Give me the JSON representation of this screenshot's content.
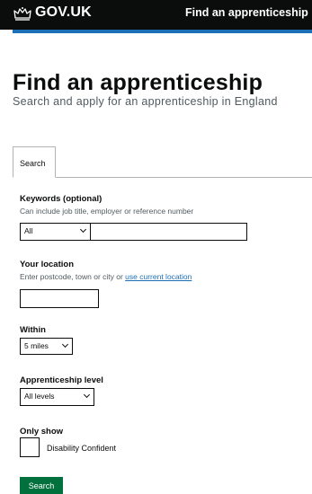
{
  "header": {
    "logo_text": "GOV.UK",
    "service_name": "Find an apprenticeship",
    "background": "#0b0c0c",
    "stripe_color": "#1d70b8"
  },
  "page": {
    "title": "Find an apprenticeship",
    "subtitle": "Search and apply for an apprenticeship in England"
  },
  "tabs": [
    {
      "label": "Search"
    }
  ],
  "form": {
    "keywords": {
      "label": "Keywords (optional)",
      "hint": "Can include job title, employer or reference number",
      "category_value": "All",
      "value": ""
    },
    "location": {
      "label": "Your location",
      "hint_prefix": "Enter postcode, town or city or ",
      "hint_link": "use current location",
      "value": ""
    },
    "within": {
      "label": "Within",
      "value": "5 miles"
    },
    "level": {
      "label": "Apprenticeship level",
      "value": "All levels"
    },
    "only_show": {
      "label": "Only show",
      "option": "Disability Confident",
      "checked": false
    },
    "submit_label": "Search",
    "submit_color": "#00703c"
  }
}
